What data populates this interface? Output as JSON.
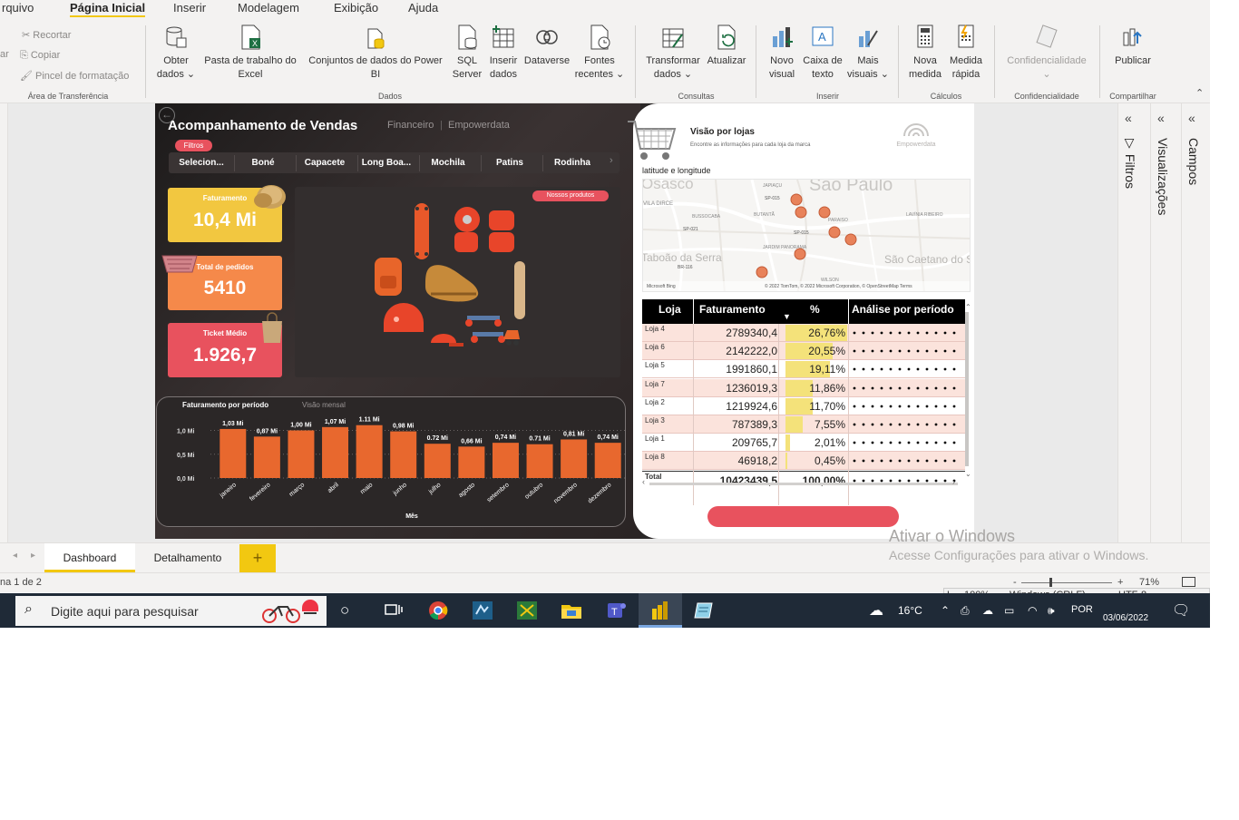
{
  "menu": {
    "tabs": [
      "rquivo",
      "Página Inicial",
      "Inserir",
      "Modelagem",
      "Exibição",
      "Ajuda"
    ],
    "active": "Página Inicial"
  },
  "ribbon": {
    "clipboard": {
      "cut": "Recortar",
      "copy": "Copiar",
      "format": "Pincel de formatação",
      "label": "Área de Transferência",
      "paste_fragment": "ar"
    },
    "data": {
      "get_data": [
        "Obter",
        "dados ⌄"
      ],
      "excel": [
        "Pasta de trabalho do",
        "Excel"
      ],
      "datasets": [
        "Conjuntos de dados do Power",
        "BI"
      ],
      "sql": [
        "SQL",
        "Server"
      ],
      "enter_data": [
        "Inserir",
        "dados"
      ],
      "dataverse": [
        "Dataverse",
        ""
      ],
      "recent": [
        "Fontes",
        "recentes ⌄"
      ],
      "label": "Dados"
    },
    "queries": {
      "transform": [
        "Transformar",
        "dados ⌄"
      ],
      "refresh": [
        "Atualizar",
        ""
      ],
      "label": "Consultas"
    },
    "insert": {
      "new_visual": [
        "Novo",
        "visual"
      ],
      "text_box": [
        "Caixa de",
        "texto"
      ],
      "more_visuals": [
        "Mais",
        "visuais ⌄"
      ],
      "label": "Inserir"
    },
    "calculations": {
      "new_measure": [
        "Nova",
        "medida"
      ],
      "quick_measure": [
        "Medida",
        "rápida"
      ],
      "label": "Cálculos"
    },
    "sensitivity": {
      "button": [
        "Confidencialidade",
        "⌄"
      ],
      "label": "Confidencialidade"
    },
    "share": {
      "publish": [
        "Publicar",
        ""
      ],
      "label": "Compartilhar"
    }
  },
  "report": {
    "title": "Acompanhamento de Vendas",
    "nav": [
      "Financeiro",
      "Empowerdata"
    ],
    "filters_label": "Filtros",
    "slicer": [
      "Selecion...",
      "Boné",
      "Capacete",
      "Long Boa...",
      "Mochila",
      "Patins",
      "Rodinha"
    ],
    "kpis": [
      {
        "label": "Faturamento",
        "value": "10,4 Mi",
        "color": "#f2c740"
      },
      {
        "label": "Total de pedidos",
        "value": "5410",
        "color": "#f5894a"
      },
      {
        "label": "Ticket Médio",
        "value": "1.926,7",
        "color": "#e8525e"
      }
    ],
    "products_label": "Nossos produtos",
    "chart_title": "Faturamento por período",
    "chart_subtitle": "Visão mensal",
    "store_view_title": "Visão por lojas",
    "store_view_subtitle": "Encontre as informações para cada loja da marca",
    "brand": "Empowerdata",
    "map_label": "latitude e longitude",
    "map": {
      "city_labels": [
        "Osasco",
        "São Paulo",
        "Taboão da Serra",
        "São Caetano do Sul"
      ],
      "district_labels": [
        "VILA DIRCE",
        "JAPIAÇU",
        "BUSSOCABA",
        "BUTANTÃ",
        "PARAISO",
        "LAVÍNIA RIBEIRO",
        "JARDIM PANORAMA",
        "WILSON"
      ],
      "roads": [
        "SP-015",
        "SP-021",
        "BR-116",
        "SP-015"
      ],
      "attribution": "© 2022 TomTom, © 2022 Microsoft Corporation, © OpenStreetMap  Terms",
      "bing": "Microsoft Bing"
    },
    "table": {
      "headers": [
        "Loja",
        "Faturamento",
        "%",
        "Análise por período"
      ],
      "rows": [
        {
          "loja": "Loja 4",
          "fat": "2789340,4",
          "pct": "26,76%",
          "pct_value": 26.76
        },
        {
          "loja": "Loja 6",
          "fat": "2142222,0",
          "pct": "20,55%",
          "pct_value": 20.55
        },
        {
          "loja": "Loja 5",
          "fat": "1991860,1",
          "pct": "19,11%",
          "pct_value": 19.11
        },
        {
          "loja": "Loja 7",
          "fat": "1236019,3",
          "pct": "11,86%",
          "pct_value": 11.86
        },
        {
          "loja": "Loja 2",
          "fat": "1219924,6",
          "pct": "11,70%",
          "pct_value": 11.7
        },
        {
          "loja": "Loja 3",
          "fat": "787389,3",
          "pct": "7,55%",
          "pct_value": 7.55
        },
        {
          "loja": "Loja 1",
          "fat": "209765,7",
          "pct": "2,01%",
          "pct_value": 2.01
        },
        {
          "loja": "Loja 8",
          "fat": "46918,2",
          "pct": "0,45%",
          "pct_value": 0.45
        }
      ],
      "total": {
        "loja": "Total",
        "fat": "10423439,5",
        "pct": "100,00%"
      }
    }
  },
  "chart_data": {
    "type": "bar",
    "title": "Faturamento por período",
    "subtitle": "Visão mensal",
    "xlabel": "Mês",
    "ylabel": "",
    "categories": [
      "janeiro",
      "fevereiro",
      "março",
      "abril",
      "maio",
      "junho",
      "julho",
      "agosto",
      "setembro",
      "outubro",
      "novembro",
      "dezembro"
    ],
    "values": [
      1.03,
      0.87,
      1.0,
      1.07,
      1.11,
      0.98,
      0.72,
      0.66,
      0.74,
      0.71,
      0.81,
      0.74
    ],
    "data_labels": [
      "1,03 Mi",
      "0,87 Mi",
      "1,00 Mi",
      "1,07 Mi",
      "1.11 Mi",
      "0,98 Mi",
      "0.72 Mi",
      "0,66 Mi",
      "0,74 Mi",
      "0.71 Mi",
      "0,81 Mi",
      "0,74 Mi"
    ],
    "yticks": [
      "0,0 Mi",
      "0,5 Mi",
      "1,0 Mi"
    ],
    "ytick_values": [
      0,
      0.5,
      1.0
    ],
    "ylim": [
      0,
      1.2
    ],
    "bar_color": "#e8682e",
    "grid": true
  },
  "panes": {
    "filters": "Filtros",
    "visualizations": "Visualizações",
    "fields": "Campos"
  },
  "page_tabs": {
    "tabs": [
      "Dashboard",
      "Detalhamento"
    ],
    "active": "Dashboard",
    "add": "+"
  },
  "watermark": {
    "line1": "Ativar o Windows",
    "line2": "Acesse Configurações para ativar o Windows."
  },
  "status": {
    "page": "na 1 de 2",
    "zoom": "71%",
    "minus": "-",
    "plus": "+"
  },
  "overlay": {
    "zoom": "100%",
    "eol": "Windows (CRLF)",
    "enc": "UTF-8"
  },
  "taskbar": {
    "search_placeholder": "Digite aqui para pesquisar",
    "weather": "16°C",
    "lang": "POR",
    "date": "03/06/2022"
  }
}
